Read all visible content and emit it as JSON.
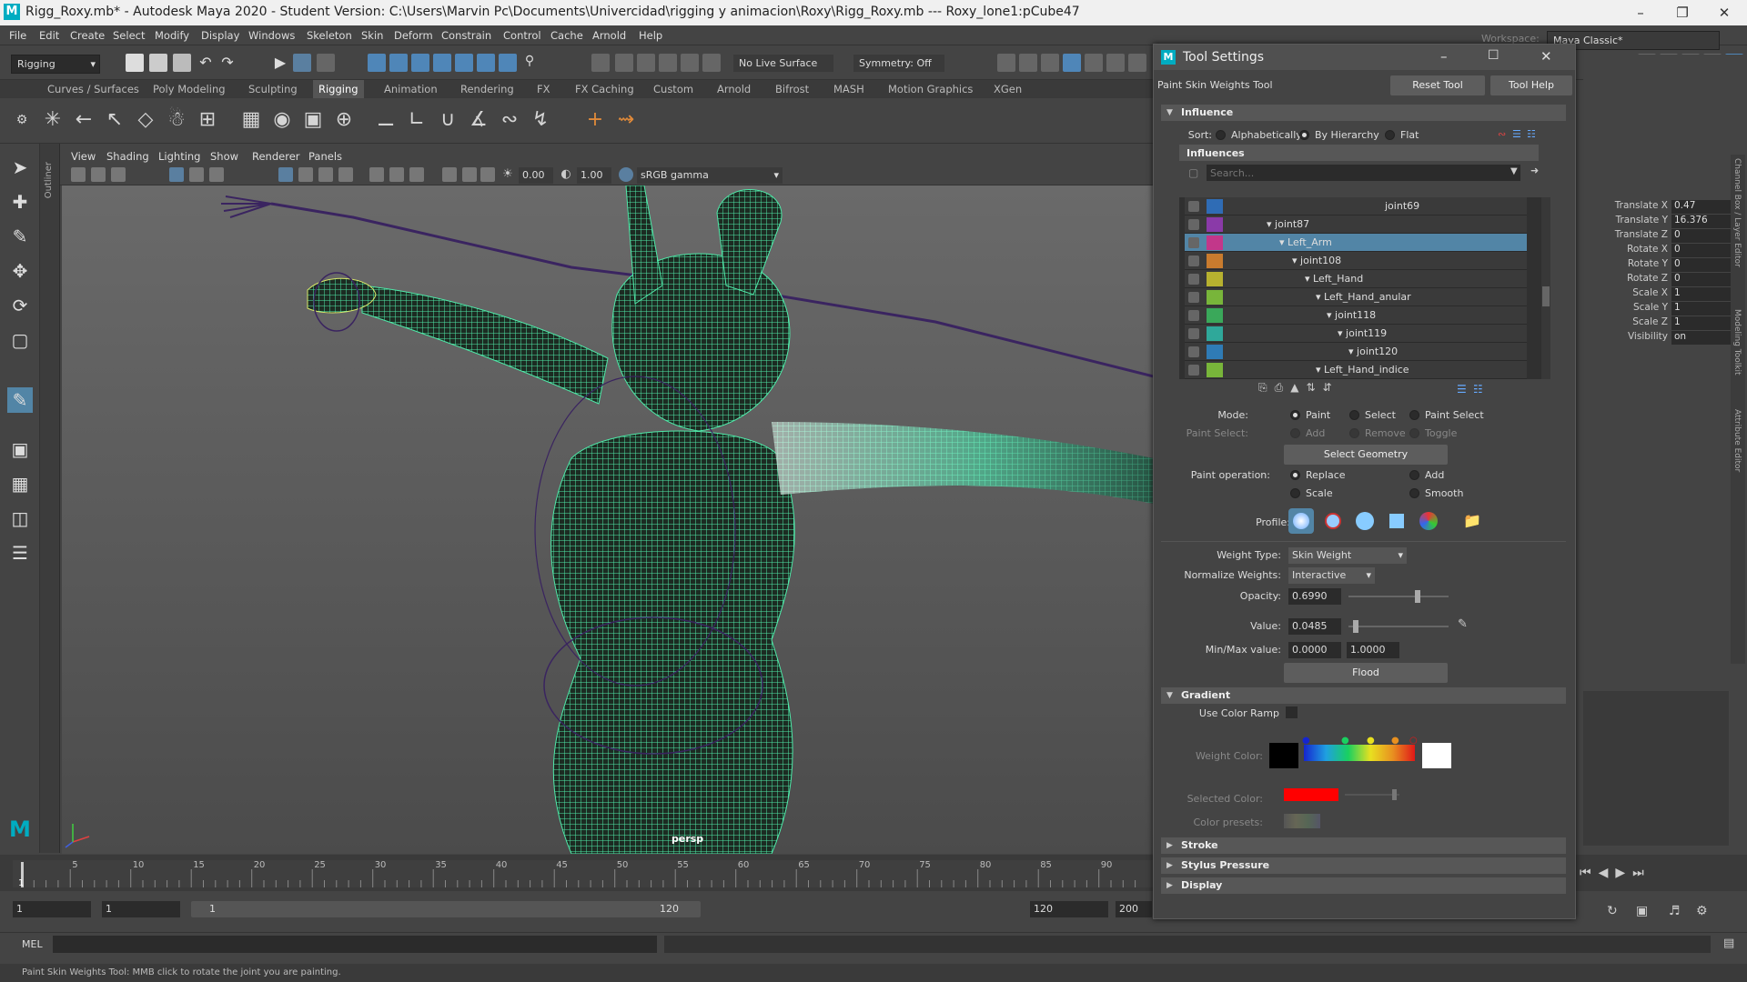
{
  "window": {
    "title": "Rigg_Roxy.mb* - Autodesk Maya 2020 - Student Version: C:\\Users\\Marvin Pc\\Documents\\Univercidad\\rigging y animacion\\Roxy\\Rigg_Roxy.mb   ---  Roxy_lone1:pCube47"
  },
  "menu": [
    "File",
    "Edit",
    "Create",
    "Select",
    "Modify",
    "Display",
    "Windows",
    "Skeleton",
    "Skin",
    "Deform",
    "Constrain",
    "Control",
    "Cache",
    "Arnold",
    "Help"
  ],
  "statusline": {
    "menuset": "Rigging",
    "live_surface": "No Live Surface",
    "symmetry": "Symmetry: Off",
    "workspace_label": "Workspace:",
    "workspace_value": "Maya Classic*"
  },
  "shelf_tabs": [
    "Curves / Surfaces",
    "Poly Modeling",
    "Sculpting",
    "Rigging",
    "Animation",
    "Rendering",
    "FX",
    "FX Caching",
    "Custom",
    "Arnold",
    "Bifrost",
    "MASH",
    "Motion Graphics",
    "XGen"
  ],
  "shelf_active": "Rigging",
  "panel_menu": [
    "View",
    "Shading",
    "Lighting",
    "Show",
    "Renderer",
    "Panels"
  ],
  "panel_tools": {
    "exposure": "0.00",
    "gamma": "1.00",
    "colorspace": "sRGB gamma"
  },
  "viewport": {
    "camera": "persp"
  },
  "outliner_label": "Outliner",
  "time": {
    "ticks": [
      "5",
      "10",
      "15",
      "20",
      "25",
      "30",
      "35",
      "40",
      "45",
      "50",
      "55",
      "60",
      "65",
      "70",
      "75",
      "80",
      "85",
      "90"
    ],
    "current": "1",
    "range_start": "1",
    "range_start2": "1",
    "range_inner_start": "1",
    "range_inner_end": "120",
    "range_end": "120",
    "anim_end": "200"
  },
  "cmdline": {
    "label": "MEL"
  },
  "helpline": "Paint Skin Weights Tool: MMB click to rotate the joint you are painting.",
  "channels": [
    {
      "name": "Translate X",
      "value": "0.47"
    },
    {
      "name": "Translate Y",
      "value": "16.376"
    },
    {
      "name": "Translate Z",
      "value": "0"
    },
    {
      "name": "Rotate X",
      "value": "0"
    },
    {
      "name": "Rotate Y",
      "value": "0"
    },
    {
      "name": "Rotate Z",
      "value": "0"
    },
    {
      "name": "Scale X",
      "value": "1"
    },
    {
      "name": "Scale Y",
      "value": "1"
    },
    {
      "name": "Scale Z",
      "value": "1"
    },
    {
      "name": "Visibility",
      "value": "on"
    }
  ],
  "side_tabs": [
    "Channel Box / Layer Editor",
    "Modeling Toolkit",
    "Attribute Editor"
  ],
  "dialog": {
    "title": "Tool Settings",
    "tool_name": "Paint Skin Weights Tool",
    "reset": "Reset Tool",
    "help": "Tool Help",
    "influence": {
      "header": "Influence",
      "sort_label": "Sort:",
      "sort_options": [
        "Alphabetically",
        "By Hierarchy",
        "Flat"
      ],
      "sort_selected": "By Hierarchy",
      "influences_label": "Influences",
      "search_placeholder": "Search...",
      "rows": [
        {
          "name": "joint69",
          "color": "#2f6cb5",
          "selected": false
        },
        {
          "name": "joint87",
          "color": "#8a3aa8",
          "selected": false
        },
        {
          "name": "Left_Arm",
          "color": "#c2378a",
          "selected": true
        },
        {
          "name": "joint108",
          "color": "#c97b2e",
          "selected": false
        },
        {
          "name": "Left_Hand",
          "color": "#b7b12f",
          "selected": false
        },
        {
          "name": "Left_Hand_anular",
          "color": "#78b53a",
          "selected": false
        },
        {
          "name": "joint118",
          "color": "#3aa85a",
          "selected": false
        },
        {
          "name": "joint119",
          "color": "#2fa89a",
          "selected": false
        },
        {
          "name": "joint120",
          "color": "#2f7bb5",
          "selected": false
        },
        {
          "name": "Left_Hand_indice",
          "color": "#78b53a",
          "selected": false
        }
      ]
    },
    "mode": {
      "label": "Mode:",
      "options": [
        "Paint",
        "Select",
        "Paint Select"
      ],
      "selected": "Paint"
    },
    "paint_select": {
      "label": "Paint Select:",
      "options": [
        "Add",
        "Remove",
        "Toggle"
      ]
    },
    "select_geometry": "Select Geometry",
    "paint_operation": {
      "label": "Paint operation:",
      "options": [
        "Replace",
        "Add",
        "Scale",
        "Smooth"
      ],
      "selected": "Replace"
    },
    "profile_label": "Profile:",
    "weight_type": {
      "label": "Weight Type:",
      "value": "Skin Weight"
    },
    "normalize": {
      "label": "Normalize Weights:",
      "value": "Interactive"
    },
    "opacity": {
      "label": "Opacity:",
      "value": "0.6990",
      "fraction": 0.699
    },
    "value": {
      "label": "Value:",
      "value": "0.0485",
      "fraction": 0.0485
    },
    "minmax": {
      "label": "Min/Max value:",
      "min": "0.0000",
      "max": "1.0000"
    },
    "flood": "Flood",
    "gradient": {
      "header": "Gradient",
      "use_ramp": "Use Color Ramp",
      "weight_color": "Weight Color:",
      "selected_color": "Selected Color:",
      "color_presets": "Color presets:"
    },
    "collapsed_sections": [
      "Stroke",
      "Stylus Pressure",
      "Display"
    ]
  }
}
